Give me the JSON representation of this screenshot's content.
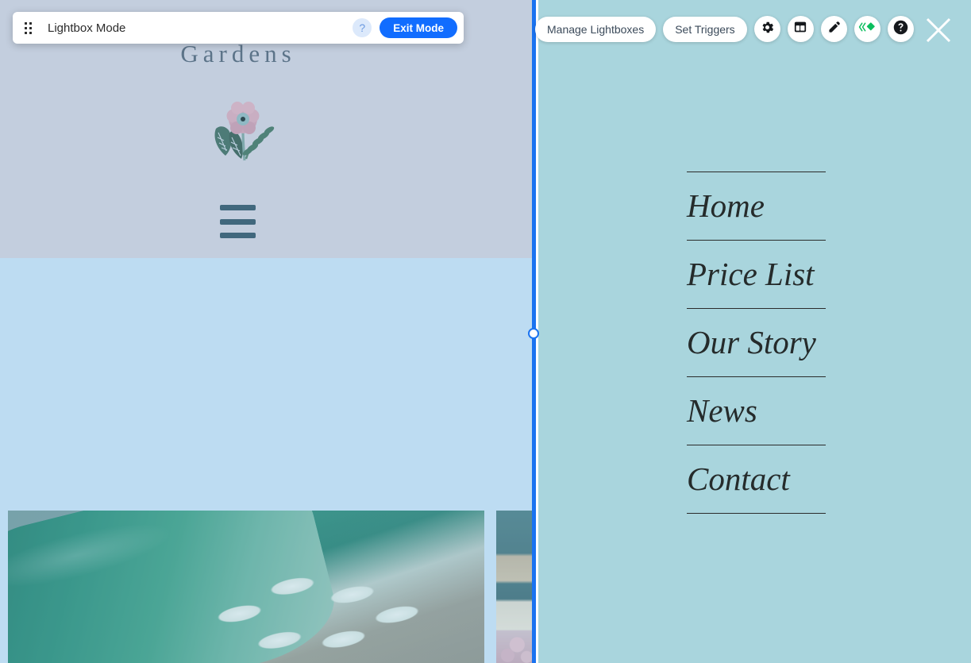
{
  "mode_bar": {
    "title": "Lightbox Mode",
    "help_label": "?",
    "exit_label": "Exit Mode",
    "grip_icon": "drag-grip-icon"
  },
  "editor_toolbar": {
    "manage_label": "Manage Lightboxes",
    "triggers_label": "Set Triggers",
    "icons": [
      {
        "name": "settings-gear-icon",
        "title": "Settings"
      },
      {
        "name": "layout-icon",
        "title": "Layout"
      },
      {
        "name": "design-pen-icon",
        "title": "Design"
      },
      {
        "name": "animation-icon",
        "title": "Animation"
      },
      {
        "name": "help-icon",
        "title": "Help"
      }
    ],
    "close_label": "close-icon"
  },
  "lightbox": {
    "background_color": "#a9d5dd",
    "menu_items": [
      {
        "label": "Home"
      },
      {
        "label": "Price List"
      },
      {
        "label": "Our Story"
      },
      {
        "label": "News"
      },
      {
        "label": "Contact"
      }
    ]
  },
  "site": {
    "title": "Gardens",
    "logo_icon": "flower-logo-icon",
    "menu_icon": "hamburger-menu-icon",
    "header_color": "#c3cede",
    "body_color": "#bddcf2",
    "images": [
      {
        "name": "white-tulips-photo"
      },
      {
        "name": "floral-decor-photo"
      }
    ]
  },
  "divider": {
    "color": "#1a73f0",
    "handle": "resize-handle"
  }
}
